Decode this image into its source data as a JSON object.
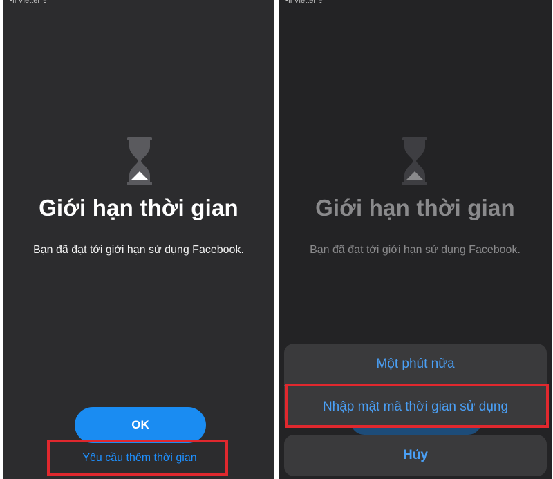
{
  "status_bar": {
    "carrier": "•ıl Viettel ᯤ",
    "time": "",
    "battery": ""
  },
  "left": {
    "title": "Giới hạn thời gian",
    "message": "Bạn đã đạt tới giới hạn sử dụng Facebook.",
    "ok_label": "OK",
    "request_more_time_label": "Yêu cầu thêm thời gian"
  },
  "right": {
    "title": "Giới hạn thời gian",
    "message": "Bạn đã đạt tới giới hạn sử dụng Facebook.",
    "action_sheet": {
      "one_minute_label": "Một phút nữa",
      "enter_passcode_label": "Nhập mật mã thời gian sử dụng",
      "cancel_label": "Hủy"
    }
  },
  "colors": {
    "accent": "#1a8cf2",
    "link": "#1e90ff",
    "highlight": "#e0282e",
    "background": "#2c2c2e"
  },
  "icons": [
    "hourglass-icon"
  ]
}
